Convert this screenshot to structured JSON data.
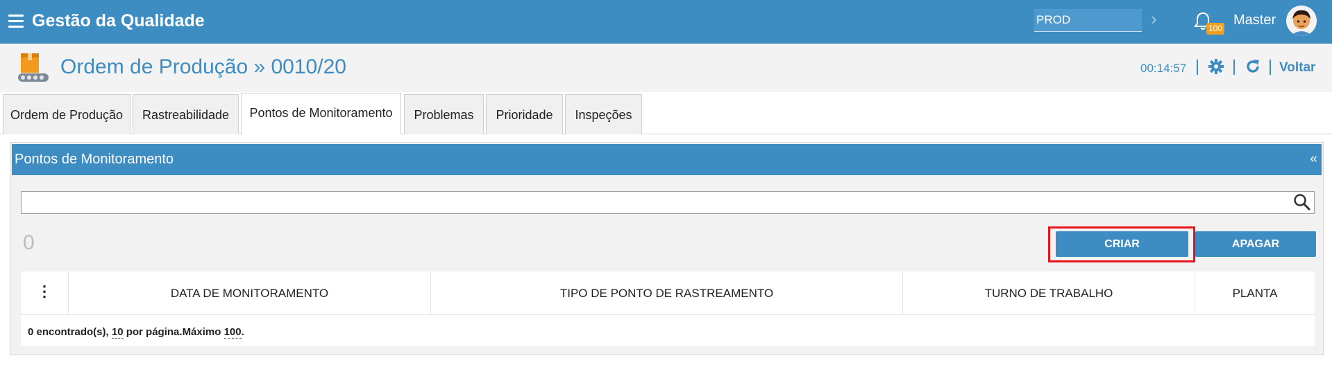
{
  "topbar": {
    "app_title": "Gestão da Qualidade",
    "environment": "PROD",
    "notification_count": "100",
    "user_name": "Master"
  },
  "header": {
    "page_title": "Ordem de Produção » 0010/20",
    "timer": "00:14:57",
    "back_label": "Voltar"
  },
  "tabs": [
    {
      "label": "Ordem de Produção",
      "active": false
    },
    {
      "label": "Rastreabilidade",
      "active": false
    },
    {
      "label": "Pontos de Monitoramento",
      "active": true
    },
    {
      "label": "Problemas",
      "active": false
    },
    {
      "label": "Prioridade",
      "active": false
    },
    {
      "label": "Inspeções",
      "active": false
    }
  ],
  "panel": {
    "title": "Pontos de Monitoramento",
    "collapse_symbol": "«",
    "search_value": "",
    "record_count": "0",
    "create_label": "CRIAR",
    "delete_label": "APAGAR"
  },
  "table": {
    "menu_symbol": "⋮",
    "columns": [
      "DATA DE MONITORAMENTO",
      "TIPO DE PONTO DE RASTREAMENTO",
      "TURNO DE TRABALHO",
      "PLANTA"
    ],
    "rows": [],
    "footer": {
      "found": "0 encontrado(s), ",
      "per_page": "10",
      "per_page_suffix": " por página.",
      "max_label": "Máximo ",
      "max": "100",
      "end": "."
    }
  },
  "colors": {
    "primary": "#3d8cc2",
    "highlight": "#e8141a",
    "badge": "#f0a020"
  }
}
